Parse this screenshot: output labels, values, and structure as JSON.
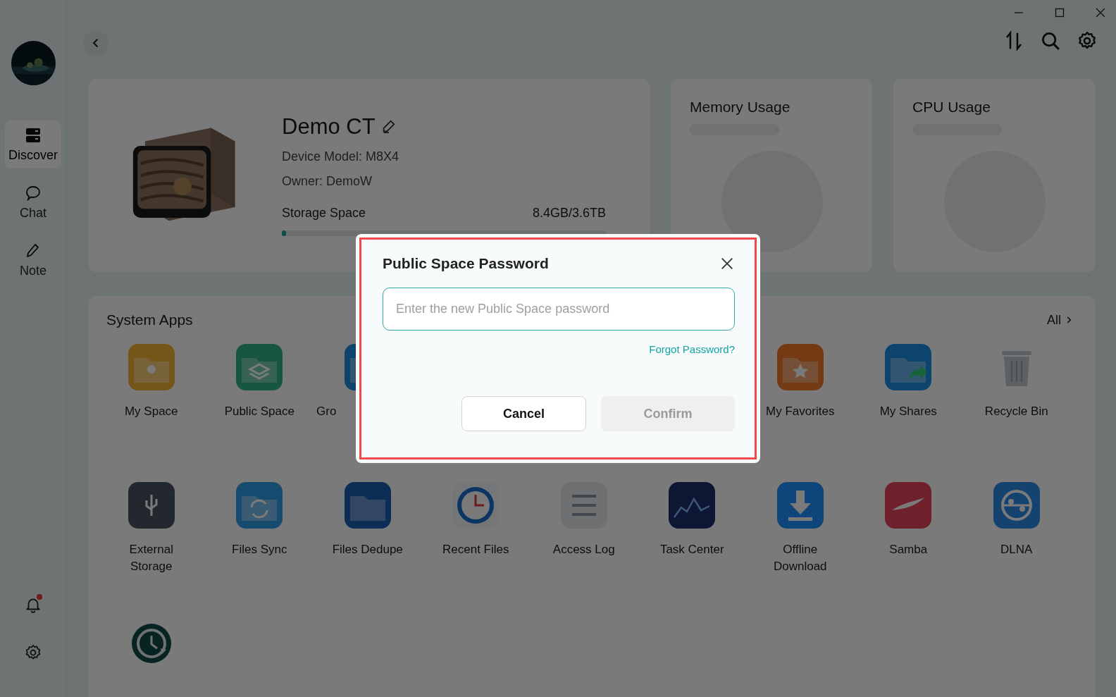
{
  "sidebar": {
    "items": [
      {
        "label": "Discover",
        "selected": true
      },
      {
        "label": "Chat",
        "selected": false
      },
      {
        "label": "Note",
        "selected": false
      }
    ],
    "notification_unread": true
  },
  "device": {
    "name": "Demo CT",
    "model": "Device Model: M8X4",
    "owner": "Owner: DemoW",
    "storage_label": "Storage Space",
    "storage_value": "8.4GB/3.6TB",
    "level": 0.01
  },
  "usage_cards": [
    {
      "title": "Memory Usage"
    },
    {
      "title": "CPU Usage"
    }
  ],
  "system_apps": {
    "title": "System Apps",
    "all_link": "All",
    "rows": [
      [
        {
          "kind": "app",
          "label": "My Space"
        },
        {
          "kind": "app",
          "label": "Public Space"
        },
        {
          "kind": "app",
          "label": "Gro"
        },
        {},
        {},
        {},
        {
          "kind": "app",
          "label": "My Favorites"
        },
        {
          "kind": "app",
          "label": "My Shares"
        },
        {
          "kind": "app",
          "label": "Recycle Bin"
        }
      ],
      [
        {
          "kind": "app",
          "label": "External Storage"
        },
        {
          "kind": "app",
          "label": "Files Sync"
        },
        {
          "kind": "app",
          "label": "Files Dedupe"
        },
        {
          "kind": "app",
          "label": "Recent Files"
        },
        {
          "kind": "app",
          "label": "Access Log"
        },
        {
          "kind": "app",
          "label": "Task Center"
        },
        {
          "kind": "app",
          "label": "Offline Download"
        },
        {
          "kind": "app",
          "label": "Samba"
        },
        {
          "kind": "app",
          "label": "DLNA"
        }
      ],
      [
        {
          "kind": "app"
        }
      ]
    ]
  },
  "dialog": {
    "title": "Public Space Password",
    "placeholder": "Enter the new Public Space password",
    "forgot_link": "Forgot Password?",
    "buttons": [
      {
        "label": "Cancel",
        "disabled": false
      },
      {
        "label": "Confirm",
        "disabled": true
      }
    ]
  }
}
